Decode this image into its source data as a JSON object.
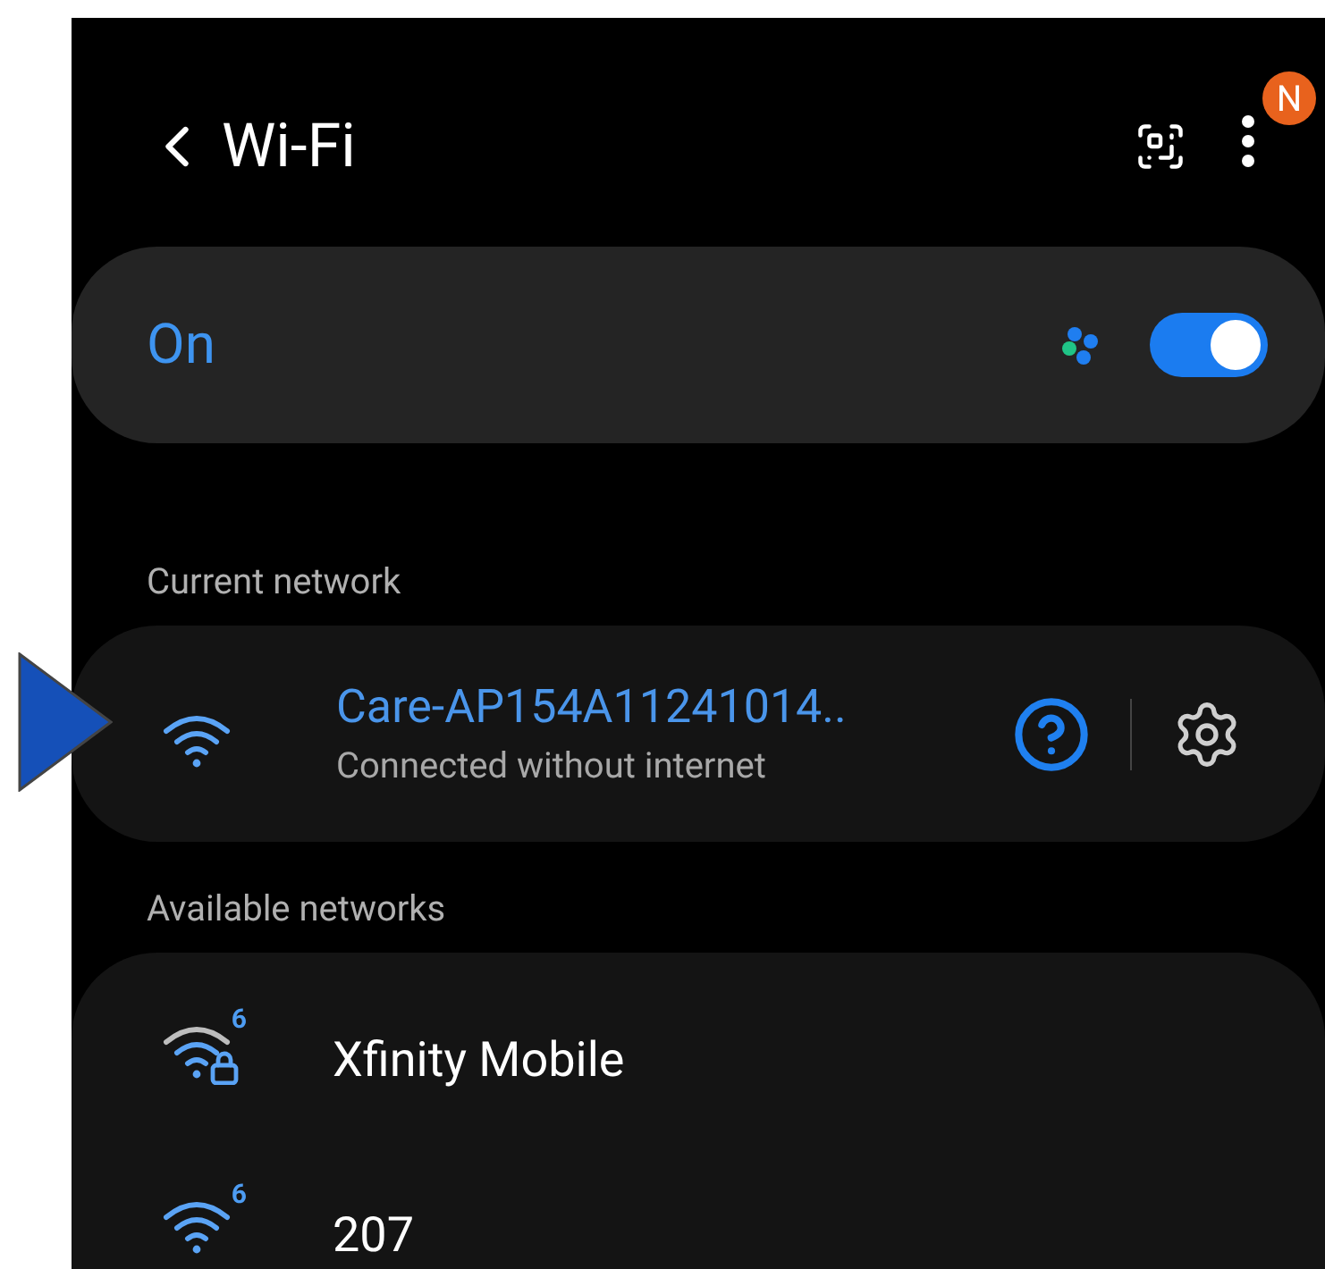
{
  "header": {
    "title": "Wi-Fi",
    "menu_badge": "N"
  },
  "master_switch": {
    "label": "On",
    "on": true
  },
  "current_section": {
    "heading": "Current network"
  },
  "current_network": {
    "name": "Care-AP154A11241014..",
    "status": "Connected without internet"
  },
  "available_section": {
    "heading": "Available networks"
  },
  "available_networks": [
    {
      "name": "Xfinity Mobile",
      "wifi_standard": "6",
      "locked": true
    },
    {
      "name": "207",
      "wifi_standard": "6",
      "locked": false
    }
  ]
}
